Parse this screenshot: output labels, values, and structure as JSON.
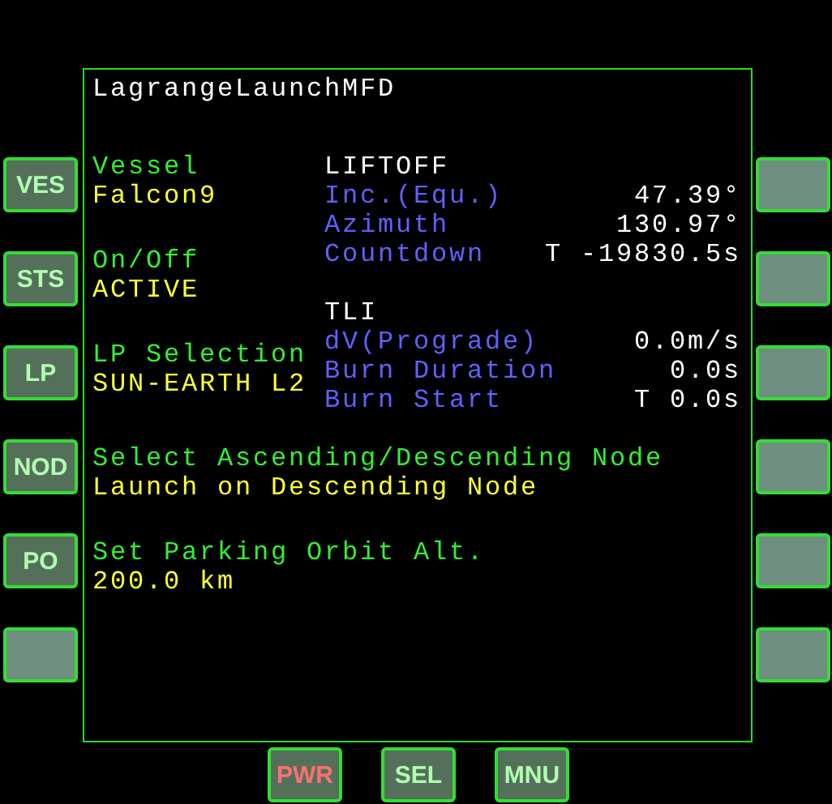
{
  "left_buttons": [
    {
      "kind": "labeled",
      "label": "VES"
    },
    {
      "kind": "labeled",
      "label": "STS"
    },
    {
      "kind": "labeled",
      "label": "LP"
    },
    {
      "kind": "labeled",
      "label": "NOD"
    },
    {
      "kind": "labeled",
      "label": "PO"
    },
    {
      "kind": "blank"
    }
  ],
  "mfd": {
    "title": "LagrangeLaunchMFD",
    "settings": [
      {
        "label": "Vessel",
        "value": "Falcon9"
      },
      {
        "label": "On/Off",
        "value": "ACTIVE"
      },
      {
        "label": "LP Selection",
        "value": "SUN-EARTH L2"
      }
    ],
    "sections": [
      {
        "heading": "LIFTOFF",
        "rows": [
          {
            "label": "Inc.(Equ.)",
            "value": "47.39°"
          },
          {
            "label": "Azimuth",
            "value": "130.97°"
          },
          {
            "label": "Countdown",
            "value": "T -19830.5s"
          }
        ]
      },
      {
        "heading": "TLI",
        "rows": [
          {
            "label": "dV(Prograde)",
            "value": "0.0m/s"
          },
          {
            "label": "Burn Duration",
            "value": "0.0s"
          },
          {
            "label": "Burn Start",
            "value": "T 0.0s"
          }
        ]
      }
    ],
    "options": [
      {
        "label": "Select Ascending/Descending Node",
        "value": "Launch on Descending Node"
      },
      {
        "label": "Set Parking Orbit Alt.",
        "value": "200.0 km"
      }
    ]
  },
  "right_buttons": [
    {
      "kind": "blank"
    },
    {
      "kind": "blank"
    },
    {
      "kind": "blank"
    },
    {
      "kind": "blank"
    },
    {
      "kind": "blank"
    },
    {
      "kind": "blank"
    }
  ],
  "bottom_buttons": [
    {
      "kind": "power",
      "label": "PWR"
    },
    {
      "kind": "labeled",
      "label": "SEL"
    },
    {
      "kind": "labeled",
      "label": "MNU"
    }
  ]
}
